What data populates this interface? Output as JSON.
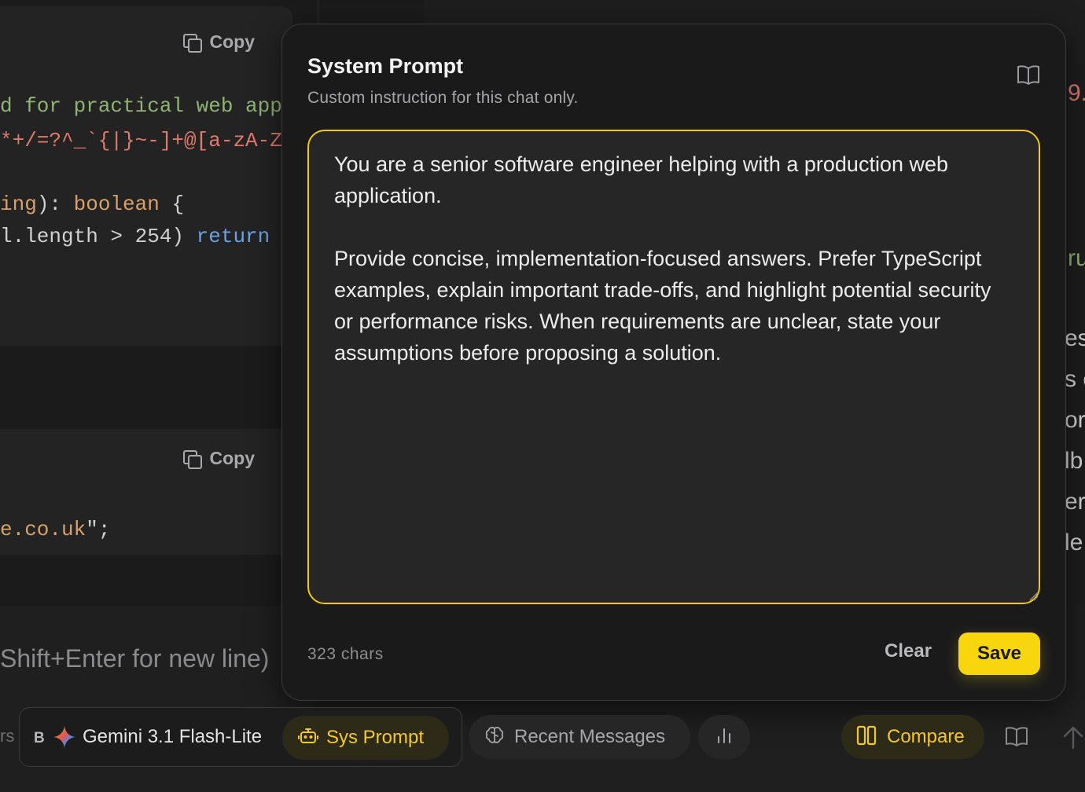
{
  "background": {
    "copy_label_1": "Copy",
    "copy_label_2": "Copy",
    "code_line_1": "d for practical web app",
    "code_line_2": "*+/=?^_`{|}~-]+@[a-zA-Z",
    "code_line_3a": "ing",
    "code_line_3b": "): ",
    "code_line_3c": "boolean",
    "code_line_3d": " {",
    "code_line_4a": "l.length > 254) ",
    "code_line_4b": "return",
    "code_line_5a": "e.co.uk",
    "code_line_5b": "\";",
    "composer_hint": "Shift+Enter for new line)",
    "right_peek_1": "9.",
    "right_peek_2": "ru",
    "right_peek_3": "es",
    "right_peek_4": "s c",
    "right_peek_5": "or",
    "right_peek_6": "lb",
    "right_peek_7": "er",
    "right_peek_8": "le"
  },
  "modal": {
    "title": "System Prompt",
    "subtitle": "Custom instruction for this chat only.",
    "prompt_text": "You are a senior software engineer helping with a production web application.\n\nProvide concise, implementation-focused answers. Prefer TypeScript examples, explain important trade-offs, and highlight potential security or performance risks. When requirements are unclear, state your assumptions before proposing a solution.",
    "char_count": "323 chars",
    "clear_label": "Clear",
    "save_label": "Save",
    "accent_color": "#f8d60e"
  },
  "toolbar": {
    "edge_text": "rs",
    "model_prefix": "B",
    "model_name": "Gemini 3.1 Flash-Lite",
    "sys_prompt_label": "Sys Prompt",
    "recent_messages_label": "Recent Messages",
    "compare_label": "Compare"
  }
}
